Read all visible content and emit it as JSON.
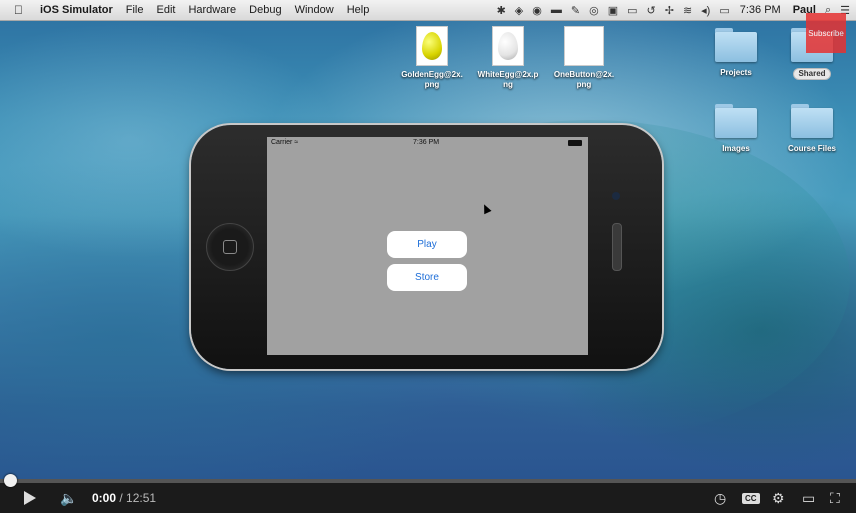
{
  "menubar": {
    "app_name": "iOS Simulator",
    "items": [
      "File",
      "Edit",
      "Hardware",
      "Debug",
      "Window",
      "Help"
    ],
    "clock": "7:36 PM",
    "user": "Paul"
  },
  "desktop": {
    "files": [
      {
        "name": "GoldenEgg@2x.png",
        "line1": "GoldenEgg@2x.",
        "line2": "png"
      },
      {
        "name": "WhiteEgg@2x.png",
        "line1": "WhiteEgg@2x.p",
        "line2": "ng"
      },
      {
        "name": "OneButton@2x.png",
        "line1": "OneButton@2x.",
        "line2": "png"
      }
    ],
    "folders": [
      "Projects",
      "Shared",
      "Images",
      "Course Files"
    ],
    "subscribe_label": "Subscribe"
  },
  "simulator": {
    "carrier": "Carrier",
    "time": "7:36 PM",
    "buttons": {
      "play": "Play",
      "store": "Store"
    }
  },
  "player": {
    "current_time": "0:00",
    "separator": " / ",
    "total_time": "12:51",
    "progress": 0.0,
    "cc_label": "CC"
  }
}
